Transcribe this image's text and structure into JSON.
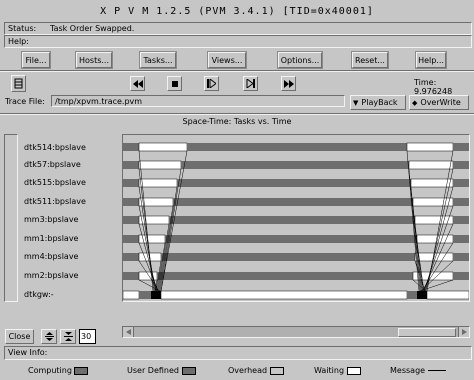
{
  "window": {
    "title": "X P V M  1.2.5  (PVM 3.4.1)  [TID=0x40001]"
  },
  "status": {
    "label": "Status:",
    "text": "Task Order Swapped."
  },
  "help": {
    "label": "Help:",
    "text": ""
  },
  "menu": {
    "file": "File...",
    "hosts": "Hosts...",
    "tasks": "Tasks...",
    "views": "Views...",
    "options": "Options...",
    "reset": "Reset...",
    "help": "Help..."
  },
  "playback": {
    "time_label": "Time:",
    "time_value": "9.976248",
    "icons": [
      "rewind-icon",
      "stop-icon",
      "step-forward-icon",
      "step-icon",
      "fast-forward-icon"
    ]
  },
  "trace": {
    "label": "Trace File:",
    "value": "/tmp/xpvm.trace.pvm",
    "playback_label": "PlayBack",
    "overwrite_label": "OverWrite"
  },
  "spacetime": {
    "title": "Space-Time: Tasks vs. Time",
    "hosts": [
      "dtk514:bpslave",
      "dtk57:bpslave",
      "dtk515:bpslave",
      "dtk511:bpslave",
      "mm3:bpslave",
      "mm1:bpslave",
      "mm4:bpslave",
      "mm2:bpslave",
      "dtkgw:-"
    ]
  },
  "controls": {
    "close": "Close",
    "zoom_value": "30"
  },
  "view_info": {
    "label": "View Info:",
    "text": ""
  },
  "legend": {
    "computing": "Computing",
    "user_defined": "User Defined",
    "overhead": "Overhead",
    "waiting": "Waiting",
    "message": "Message",
    "colors": {
      "computing": "#6e6e6e",
      "user_defined": "#6e6e6e",
      "overhead": "#c6c6c6",
      "waiting": "#ffffff",
      "message": "#000000"
    }
  }
}
